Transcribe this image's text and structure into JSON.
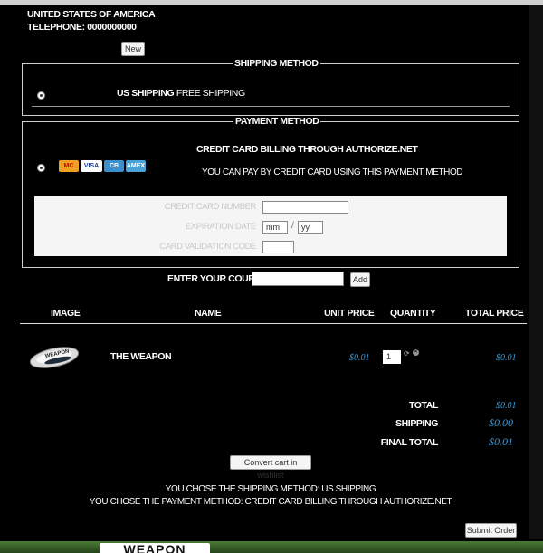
{
  "address": {
    "country": "UNITED STATES OF AMERICA",
    "telephone": "TELEPHONE: 0000000000",
    "new_button": "New"
  },
  "shipping": {
    "legend": "SHIPPING METHOD",
    "option_name": "US SHIPPING",
    "option_desc": "FREE SHIPPING"
  },
  "payment": {
    "legend": "PAYMENT METHOD",
    "title": "CREDIT CARD BILLING THROUGH AUTHORIZE.NET",
    "subtitle": "YOU CAN PAY BY CREDIT CARD USING THIS PAYMENT METHOD",
    "cards": [
      "MC",
      "VISA",
      "CB",
      "AMEX"
    ],
    "cc_number_label": "CREDIT CARD NUMBER",
    "expiration_label": "EXPIRATION DATE",
    "exp_month_placeholder": "mm",
    "exp_separator": "/",
    "exp_year_placeholder": "yy",
    "cvc_label": "CARD VALIDATION CODE"
  },
  "coupon": {
    "label": "ENTER YOUR COUPON",
    "value": "",
    "add_button": "Add"
  },
  "cart": {
    "headers": {
      "image": "IMAGE",
      "name": "NAME",
      "unit_price": "UNIT PRICE",
      "quantity": "QUANTITY",
      "total_price": "TOTAL PRICE"
    },
    "items": [
      {
        "image_text": "WEAPON",
        "name": "THE WEAPON",
        "unit_price": "$0.01",
        "quantity": "1",
        "total_price": "$0.01"
      }
    ]
  },
  "summary": {
    "total_label": "TOTAL",
    "total_value": "$0.01",
    "shipping_label": "SHIPPING",
    "shipping_value": "$0.00",
    "final_label": "FINAL TOTAL",
    "final_value": "$0.01"
  },
  "wishlist_button": "Convert cart in wishlist",
  "chosen_shipping": "YOU CHOSE THE SHIPPING METHOD: US SHIPPING",
  "chosen_payment": "YOU CHOSE THE PAYMENT METHOD: CREDIT CARD BILLING THROUGH AUTHORIZE.NET",
  "submit_button": "Submit Order",
  "footer_logo": "WEAPON",
  "colors": {
    "background": "#000000",
    "price_blue": "#3d9bd8",
    "border": "#cfcfcf",
    "footer_green": "#2e5a1f"
  }
}
